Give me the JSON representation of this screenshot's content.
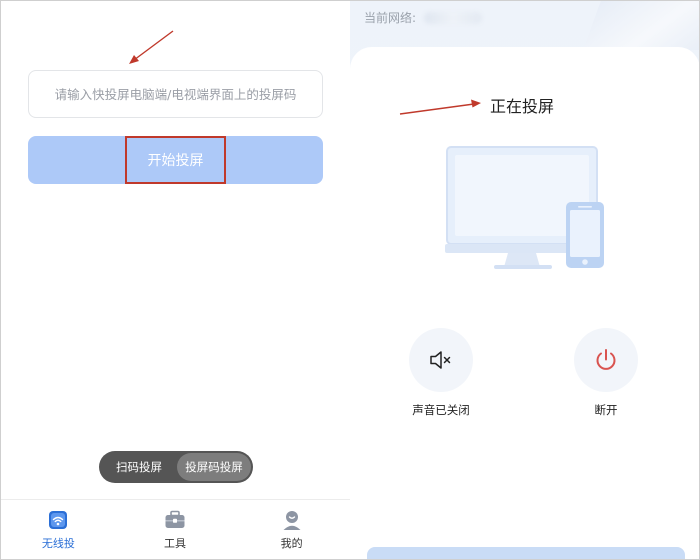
{
  "left_panel": {
    "code_input": {
      "placeholder": "请输入快投屏电脑端/电视端界面上的投屏码",
      "value": ""
    },
    "start_button": {
      "label": "开始投屏",
      "color": "#adc9f8"
    },
    "mode_toggle": {
      "options": [
        {
          "label": "扫码投屏",
          "selected": false
        },
        {
          "label": "投屏码投屏",
          "selected": true
        }
      ]
    },
    "tabbar": {
      "items": [
        {
          "label": "无线投",
          "icon": "wireless-cast-icon",
          "active": true
        },
        {
          "label": "工具",
          "icon": "toolbox-icon",
          "active": false
        },
        {
          "label": "我的",
          "icon": "profile-icon",
          "active": false
        }
      ]
    }
  },
  "right_panel": {
    "network_label": "当前网络:",
    "status_title": "正在投屏",
    "illustration": "monitor-and-phone-icon",
    "controls": {
      "mute": {
        "label": "声音已关闭",
        "icon": "speaker-muted-icon"
      },
      "disconnect": {
        "label": "断开",
        "icon": "power-icon",
        "color": "#d9534f"
      }
    }
  },
  "colors": {
    "accent": "#2b6fd6",
    "annotation": "#c0392b"
  }
}
